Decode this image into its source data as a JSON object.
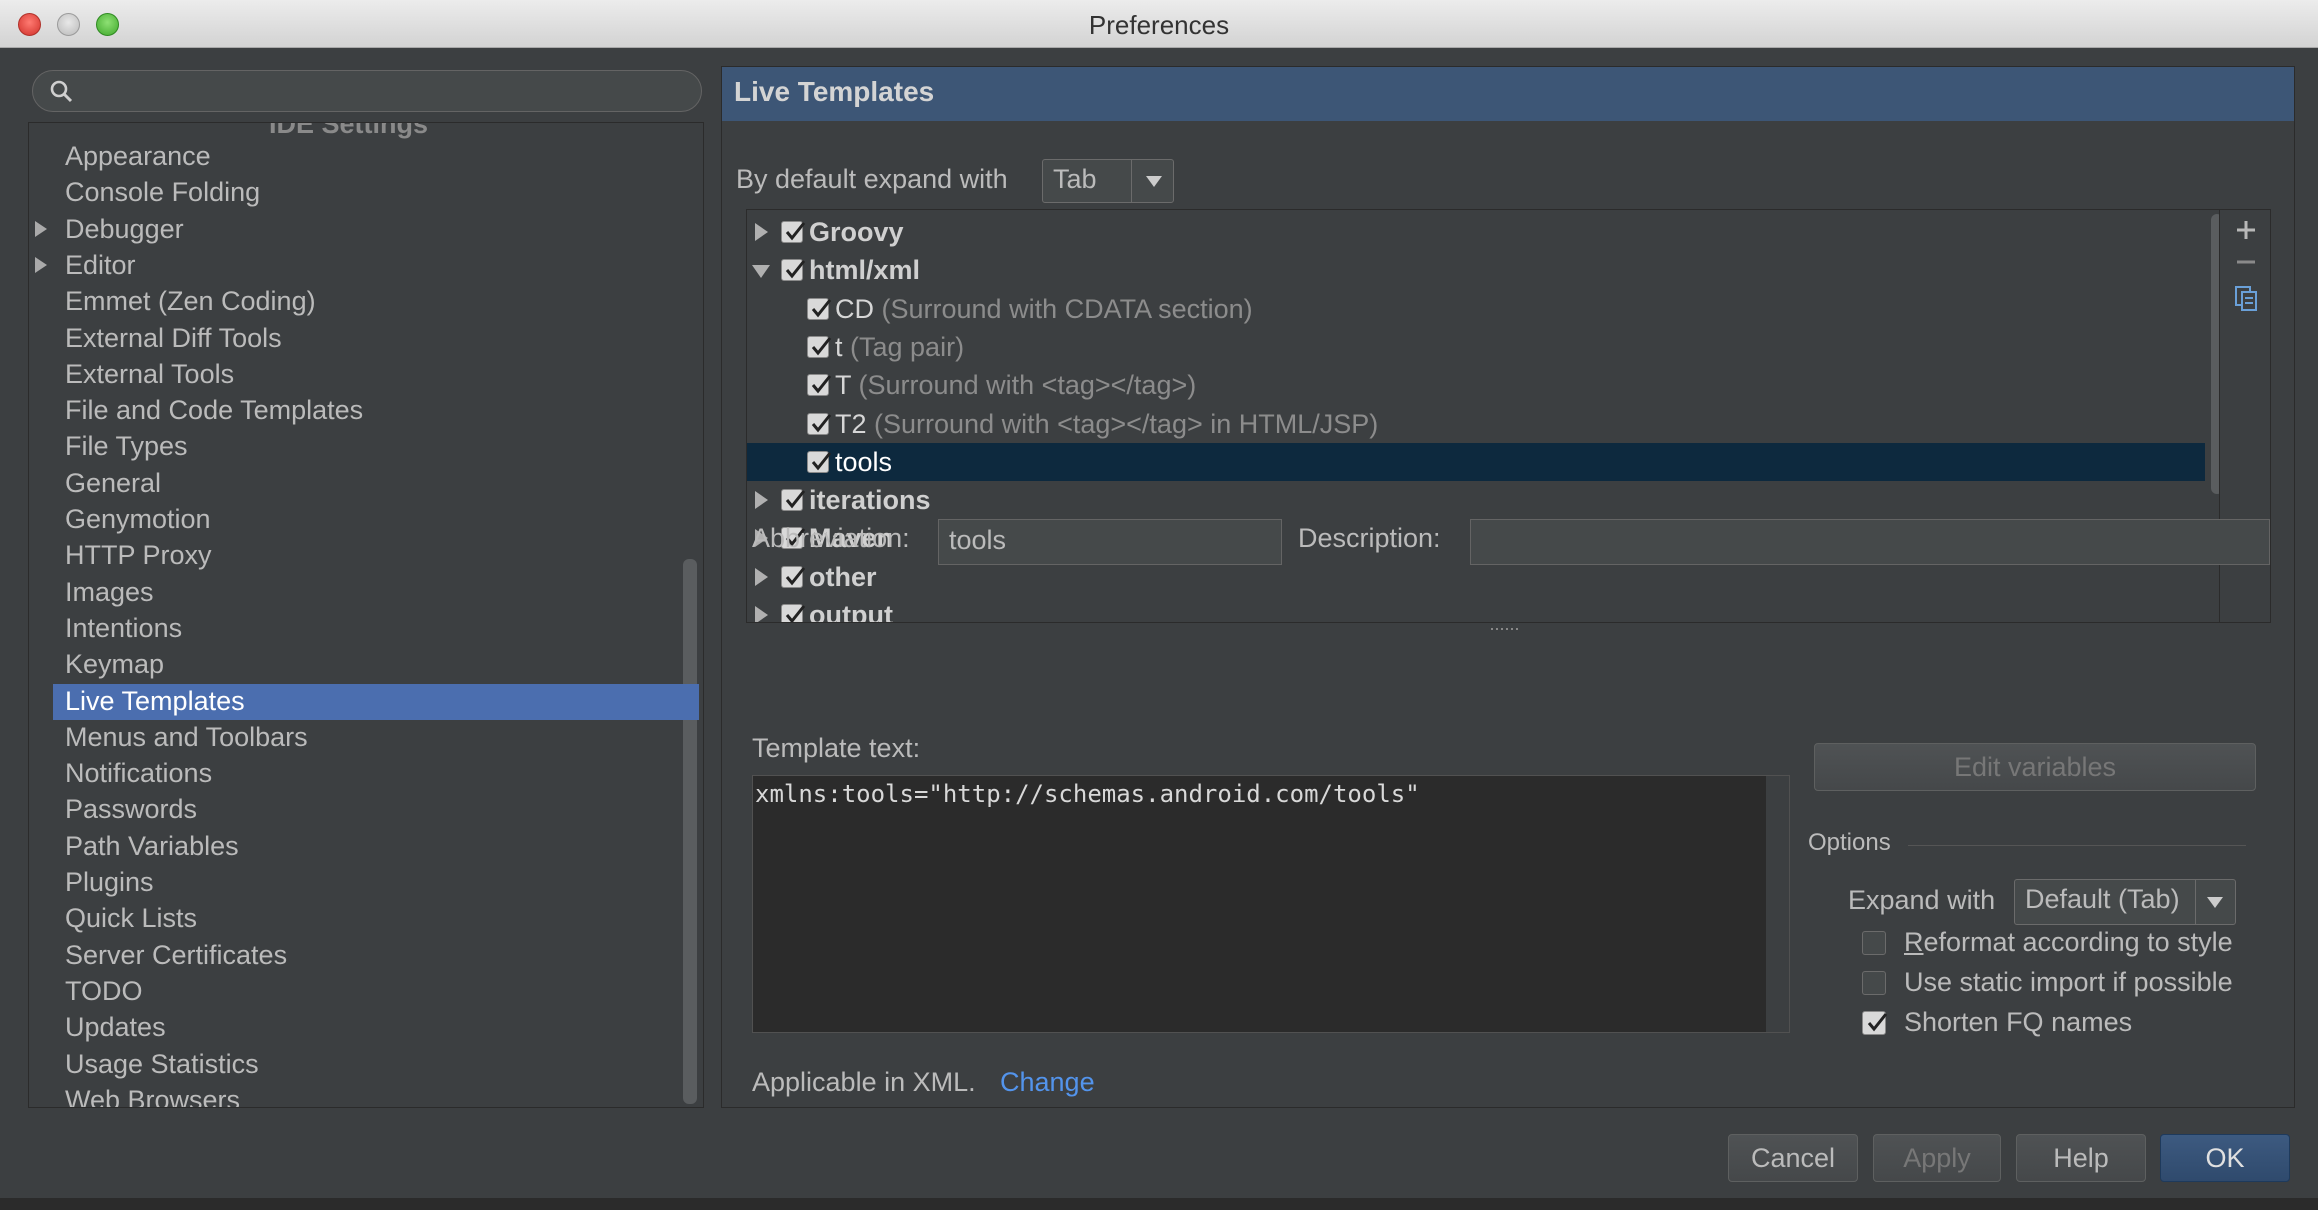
{
  "window": {
    "title": "Preferences"
  },
  "search": {
    "placeholder": ""
  },
  "sidebar": {
    "section_cut": "IDE Settings",
    "items": [
      {
        "label": "Appearance",
        "expandable": false
      },
      {
        "label": "Console Folding",
        "expandable": false
      },
      {
        "label": "Debugger",
        "expandable": true
      },
      {
        "label": "Editor",
        "expandable": true
      },
      {
        "label": "Emmet (Zen Coding)",
        "expandable": false
      },
      {
        "label": "External Diff Tools",
        "expandable": false
      },
      {
        "label": "External Tools",
        "expandable": false
      },
      {
        "label": "File and Code Templates",
        "expandable": false
      },
      {
        "label": "File Types",
        "expandable": false
      },
      {
        "label": "General",
        "expandable": false
      },
      {
        "label": "Genymotion",
        "expandable": false
      },
      {
        "label": "HTTP Proxy",
        "expandable": false
      },
      {
        "label": "Images",
        "expandable": false
      },
      {
        "label": "Intentions",
        "expandable": false
      },
      {
        "label": "Keymap",
        "expandable": false
      },
      {
        "label": "Live Templates",
        "expandable": false,
        "selected": true
      },
      {
        "label": "Menus and Toolbars",
        "expandable": false
      },
      {
        "label": "Notifications",
        "expandable": false
      },
      {
        "label": "Passwords",
        "expandable": false
      },
      {
        "label": "Path Variables",
        "expandable": false
      },
      {
        "label": "Plugins",
        "expandable": false
      },
      {
        "label": "Quick Lists",
        "expandable": false
      },
      {
        "label": "Server Certificates",
        "expandable": false
      },
      {
        "label": "TODO",
        "expandable": false
      },
      {
        "label": "Updates",
        "expandable": false
      },
      {
        "label": "Usage Statistics",
        "expandable": false
      },
      {
        "label": "Web Browsers",
        "expandable": false
      }
    ]
  },
  "panel": {
    "title": "Live Templates",
    "expand_label": "By default expand with",
    "expand_value": "Tab",
    "templates": [
      {
        "level": 0,
        "name": "Groovy",
        "desc": "",
        "expanded": false,
        "checked": true
      },
      {
        "level": 0,
        "name": "html/xml",
        "desc": "",
        "expanded": true,
        "checked": true
      },
      {
        "level": 1,
        "name": "CD",
        "desc": "(Surround with CDATA section)",
        "checked": true
      },
      {
        "level": 1,
        "name": "t",
        "desc": "(Tag pair)",
        "checked": true
      },
      {
        "level": 1,
        "name": "T",
        "desc": "(Surround with <tag></tag>)",
        "checked": true
      },
      {
        "level": 1,
        "name": "T2",
        "desc": "(Surround with <tag></tag> in HTML/JSP)",
        "checked": true
      },
      {
        "level": 1,
        "name": "tools",
        "desc": "",
        "checked": true,
        "selected": true
      },
      {
        "level": 0,
        "name": "iterations",
        "desc": "",
        "expanded": false,
        "checked": true
      },
      {
        "level": 0,
        "name": "Maven",
        "desc": "",
        "expanded": false,
        "checked": true
      },
      {
        "level": 0,
        "name": "other",
        "desc": "",
        "expanded": false,
        "checked": true
      },
      {
        "level": 0,
        "name": "output",
        "desc": "",
        "expanded": false,
        "checked": true
      }
    ],
    "tools": {
      "add": "plus-icon",
      "remove": "minus-icon",
      "copy": "copy-icon"
    },
    "abbreviation_label": "Abbreviation:",
    "abbreviation_value": "tools",
    "description_label": "Description:",
    "description_value": "",
    "template_text_label": "Template text:",
    "template_text": "xmlns:tools=\"http://schemas.android.com/tools\"",
    "edit_variables": "Edit variables",
    "options_label": "Options",
    "expand_with_label": "Expand with",
    "expand_with_value": "Default (Tab)",
    "reformat_label": "Reformat according to style",
    "reformat_checked": false,
    "static_import_label": "Use static import if possible",
    "static_import_checked": false,
    "shorten_label": "Shorten FQ names",
    "shorten_checked": true,
    "applicable_label": "Applicable in XML.",
    "change_link": "Change"
  },
  "footer": {
    "cancel": "Cancel",
    "apply": "Apply",
    "help": "Help",
    "ok": "OK"
  },
  "colors": {
    "accent": "#4b6eaf",
    "header": "#3d5676",
    "tree_selection": "#0d293e",
    "link": "#5394ec"
  }
}
